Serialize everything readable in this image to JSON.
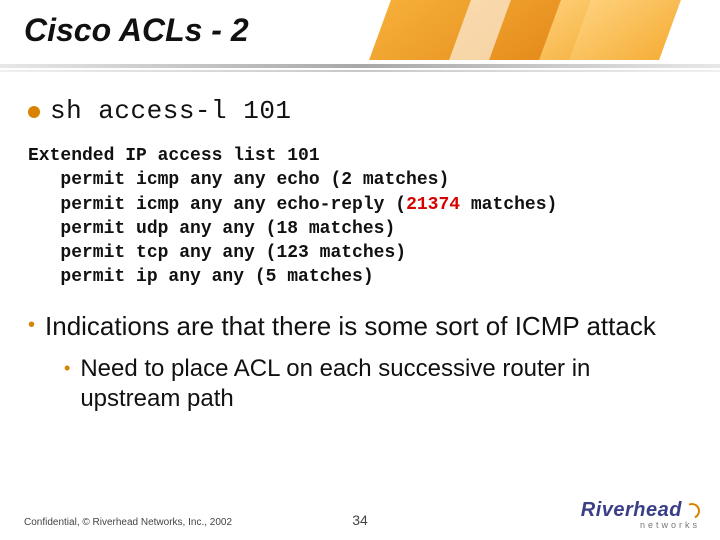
{
  "title": "Cisco ACLs - 2",
  "command": "sh access-l 101",
  "acl": {
    "header": "Extended IP access list 101",
    "lines": [
      {
        "text": "   permit icmp any any echo (2 matches)",
        "hl": ""
      },
      {
        "text": "   permit icmp any any echo-reply (",
        "hl": "21374",
        "tail": " matches)"
      },
      {
        "text": "   permit udp any any (18 matches)",
        "hl": ""
      },
      {
        "text": "   permit tcp any any (123 matches)",
        "hl": ""
      },
      {
        "text": "   permit ip any any (5 matches)",
        "hl": ""
      }
    ]
  },
  "point1": "Indications are that there is some sort of ICMP attack",
  "point2": "Need to place ACL on each successive router in upstream path",
  "footer": "Confidential, © Riverhead Networks, Inc., 2002",
  "page": "34",
  "logo": {
    "name": "Riverhead",
    "sub": "networks"
  }
}
